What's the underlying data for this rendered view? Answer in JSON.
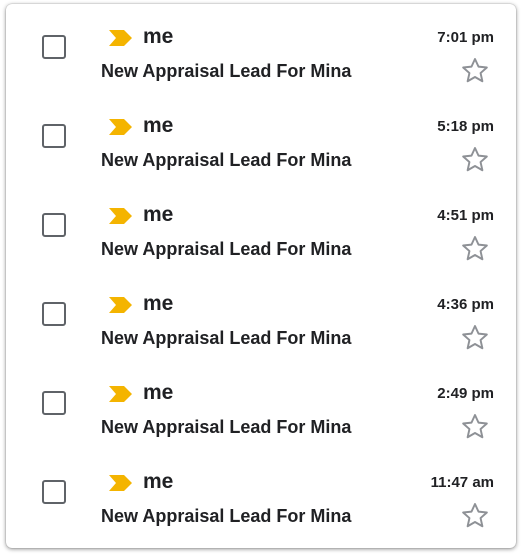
{
  "messages": [
    {
      "sender": "me",
      "subject": "New Appraisal Lead For Mina",
      "time": "7:01 pm",
      "starred": false
    },
    {
      "sender": "me",
      "subject": "New Appraisal Lead For Mina",
      "time": "5:18 pm",
      "starred": false
    },
    {
      "sender": "me",
      "subject": "New Appraisal Lead For Mina",
      "time": "4:51 pm",
      "starred": false
    },
    {
      "sender": "me",
      "subject": "New Appraisal Lead For Mina",
      "time": "4:36 pm",
      "starred": false
    },
    {
      "sender": "me",
      "subject": "New Appraisal Lead For Mina",
      "time": "2:49 pm",
      "starred": false
    },
    {
      "sender": "me",
      "subject": "New Appraisal Lead For Mina",
      "time": "11:47 am",
      "starred": false
    }
  ],
  "icons": {
    "checkbox": "checkbox-icon",
    "importance_marker": "importance-marker-icon",
    "star": "star-icon"
  },
  "colors": {
    "importance_marker": "#f4b400",
    "star_outline": "#8e9196",
    "checkbox_border": "#5f6368",
    "text": "#202124"
  }
}
